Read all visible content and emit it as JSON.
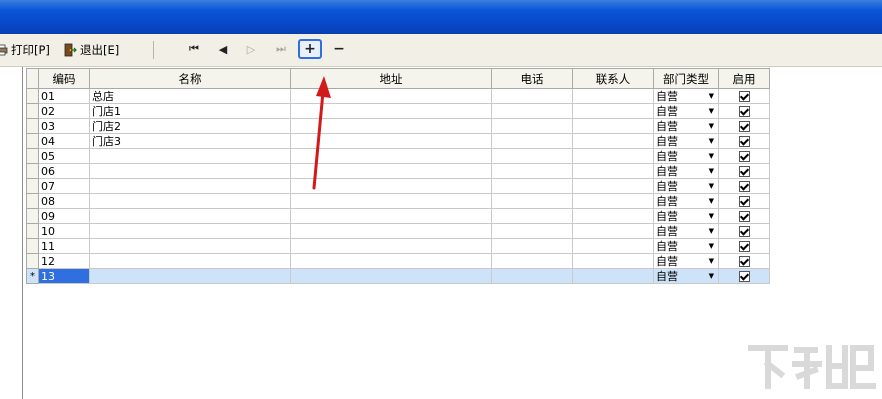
{
  "toolbar": {
    "print_label": "打印[P]",
    "exit_label": "退出[E]"
  },
  "navigator": {
    "first": "⏮",
    "prev": "◀",
    "next": "▷",
    "last": "⏭",
    "add": "+",
    "delete": "−"
  },
  "grid": {
    "columns": [
      "编码",
      "名称",
      "地址",
      "电话",
      "联系人",
      "部门类型",
      "启用"
    ],
    "rows": [
      {
        "code": "01",
        "name": "总店",
        "addr": "",
        "phone": "",
        "contact": "",
        "type": "自营",
        "enabled": true
      },
      {
        "code": "02",
        "name": "门店1",
        "addr": "",
        "phone": "",
        "contact": "",
        "type": "自营",
        "enabled": true
      },
      {
        "code": "03",
        "name": "门店2",
        "addr": "",
        "phone": "",
        "contact": "",
        "type": "自营",
        "enabled": true
      },
      {
        "code": "04",
        "name": "门店3",
        "addr": "",
        "phone": "",
        "contact": "",
        "type": "自营",
        "enabled": true
      },
      {
        "code": "05",
        "name": "",
        "addr": "",
        "phone": "",
        "contact": "",
        "type": "自营",
        "enabled": true
      },
      {
        "code": "06",
        "name": "",
        "addr": "",
        "phone": "",
        "contact": "",
        "type": "自营",
        "enabled": true
      },
      {
        "code": "07",
        "name": "",
        "addr": "",
        "phone": "",
        "contact": "",
        "type": "自营",
        "enabled": true
      },
      {
        "code": "08",
        "name": "",
        "addr": "",
        "phone": "",
        "contact": "",
        "type": "自营",
        "enabled": true
      },
      {
        "code": "09",
        "name": "",
        "addr": "",
        "phone": "",
        "contact": "",
        "type": "自营",
        "enabled": true
      },
      {
        "code": "10",
        "name": "",
        "addr": "",
        "phone": "",
        "contact": "",
        "type": "自营",
        "enabled": true
      },
      {
        "code": "11",
        "name": "",
        "addr": "",
        "phone": "",
        "contact": "",
        "type": "自营",
        "enabled": true
      },
      {
        "code": "12",
        "name": "",
        "addr": "",
        "phone": "",
        "contact": "",
        "type": "自营",
        "enabled": true
      },
      {
        "code": "13",
        "name": "",
        "addr": "",
        "phone": "",
        "contact": "",
        "type": "自营",
        "enabled": true,
        "selected": true,
        "indicator": "*"
      }
    ]
  },
  "colors": {
    "titlebar": "#0845c4",
    "selection": "#2f6fe0",
    "selected_row": "#cde3f9",
    "annotation_arrow": "#d11a1a"
  },
  "icons": {
    "print": "printer-icon",
    "exit": "exit-door-icon"
  }
}
